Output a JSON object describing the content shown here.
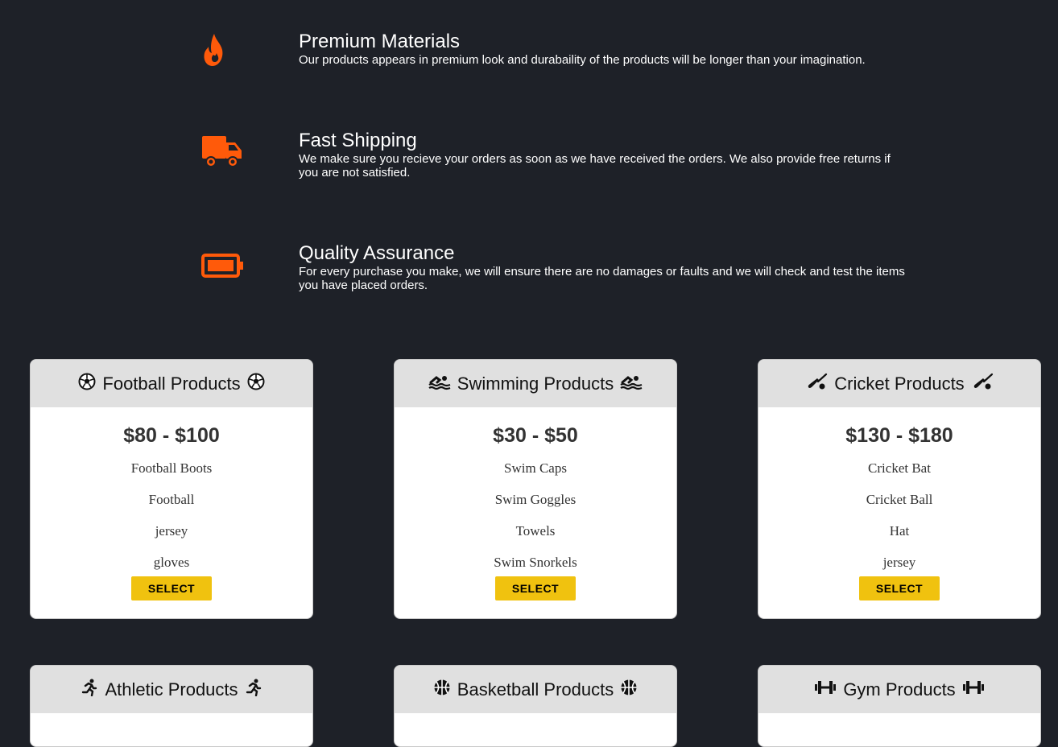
{
  "features": [
    {
      "icon": "fire-icon",
      "title": "Premium Materials",
      "description": "Our products appears in premium look and durabaility of the products will be longer than your imagination."
    },
    {
      "icon": "truck-icon",
      "title": "Fast Shipping",
      "description": "We make sure you recieve your orders as soon as we have received the orders. We also provide free returns if you are not satisfied."
    },
    {
      "icon": "battery-icon",
      "title": "Quality Assurance",
      "description": "For every purchase you make, we will ensure there are no damages or faults and we will check and test the items you have placed orders."
    }
  ],
  "accent_color": "#ff5a0a",
  "button_color": "#f0c20f",
  "cards": [
    {
      "icon": "football-icon",
      "title": "Football Products",
      "price": "$80 - $100",
      "items": [
        "Football Boots",
        "Football",
        "jersey",
        "gloves"
      ],
      "button": "SELECT"
    },
    {
      "icon": "swimmer-icon",
      "title": "Swimming Products",
      "price": "$30 - $50",
      "items": [
        "Swim Caps",
        "Swim Goggles",
        "Towels",
        "Swim Snorkels"
      ],
      "button": "SELECT"
    },
    {
      "icon": "cricket-icon",
      "title": "Cricket Products",
      "price": "$130 - $180",
      "items": [
        "Cricket Bat",
        "Cricket Ball",
        "Hat",
        "jersey"
      ],
      "button": "SELECT"
    },
    {
      "icon": "running-icon",
      "title": "Athletic Products"
    },
    {
      "icon": "basketball-icon",
      "title": "Basketball Products"
    },
    {
      "icon": "dumbbell-icon",
      "title": "Gym Products"
    }
  ]
}
